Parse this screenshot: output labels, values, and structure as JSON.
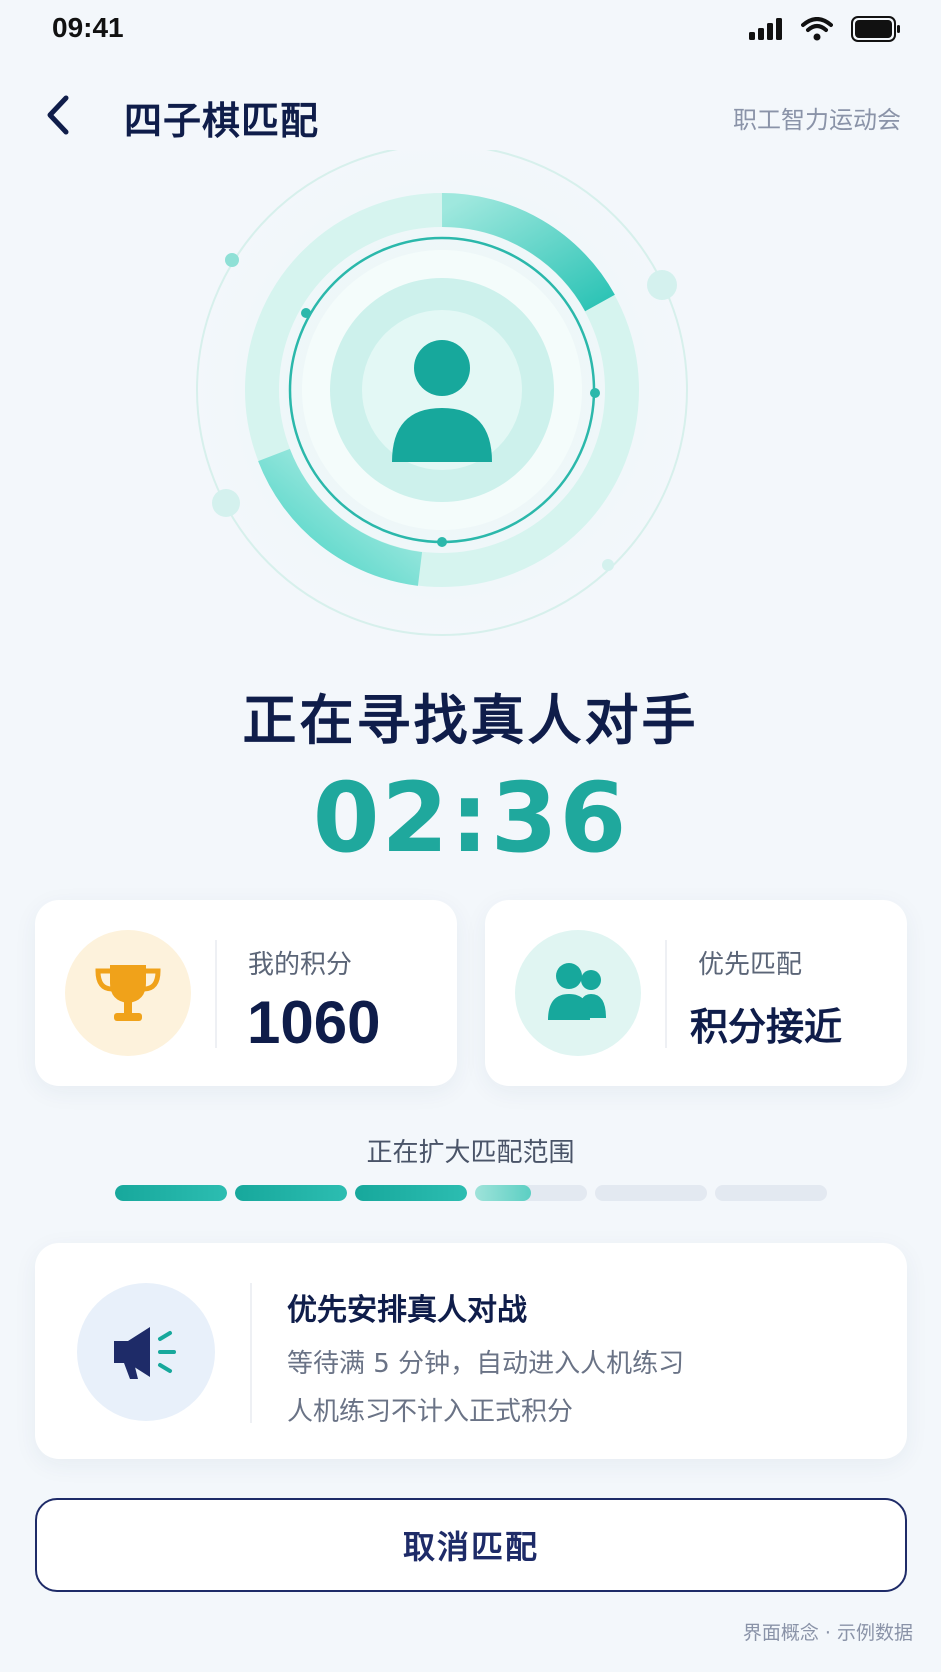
{
  "status_bar": {
    "time": "09:41",
    "icons": [
      "signal-icon",
      "wifi-icon",
      "battery-icon"
    ]
  },
  "nav": {
    "back_icon": "chevron-left-icon",
    "title": "四子棋匹配",
    "brand": "职工智力运动会"
  },
  "radar": {
    "avatar_icon": "user-avatar-icon",
    "accent": "#1fa89d"
  },
  "status": {
    "heading": "正在寻找真人对手",
    "timer": "02:36"
  },
  "score_card": {
    "icon": "trophy-icon",
    "label": "我的积分",
    "value": "1060"
  },
  "match_card": {
    "icon": "people-icon",
    "label": "优先匹配",
    "value": "积分接近"
  },
  "expanding": {
    "label": "正在扩大匹配范围",
    "segments_total": 6,
    "segments_filled": 3.5
  },
  "notice": {
    "icon": "megaphone-icon",
    "title": "优先安排真人对战",
    "line1": "等待满 5 分钟，自动进入人机练习",
    "line2": "人机练习不计入正式积分"
  },
  "cancel_button": "取消匹配",
  "footnote": "界面概念 · 示例数据",
  "colors": {
    "primary": "#0f1d4a",
    "accent": "#1fa89d",
    "trophy": "#f0a21a",
    "background": "#f3f7fb"
  }
}
